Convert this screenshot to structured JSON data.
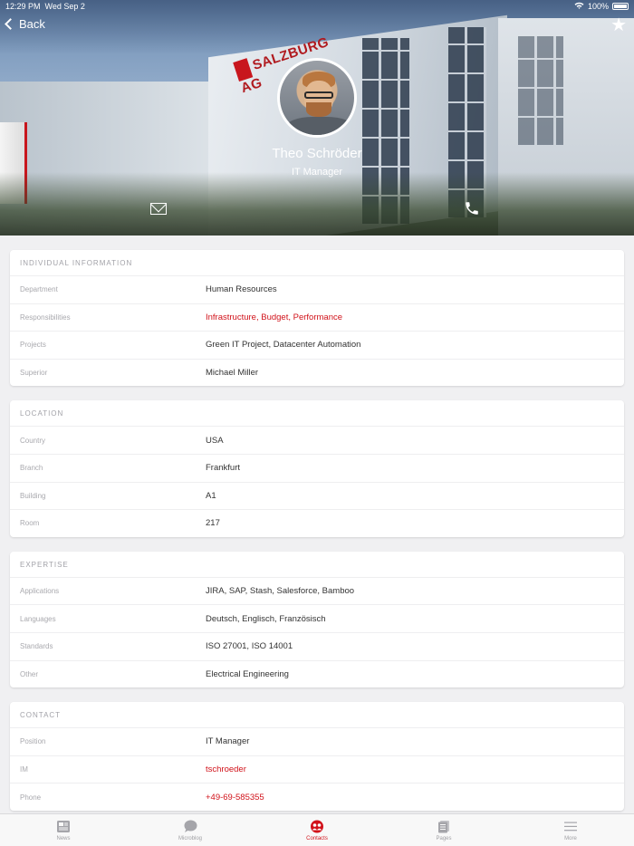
{
  "status_bar": {
    "time": "12:29 PM",
    "date": "Wed Sep 2",
    "battery": "100%"
  },
  "header": {
    "back_label": "Back",
    "sign_text": "SALZBURG AG",
    "name": "Theo Schröder",
    "role": "IT Manager"
  },
  "sections": [
    {
      "title": "INDIVIDUAL INFORMATION",
      "rows": [
        {
          "label": "Department",
          "value": "Human Resources",
          "link": false
        },
        {
          "label": "Responsibilities",
          "value": "Infrastructure, Budget, Performance",
          "link": true
        },
        {
          "label": "Projects",
          "value": "Green IT Project, Datacenter Automation",
          "link": false
        },
        {
          "label": "Superior",
          "value": "Michael Miller",
          "link": false
        }
      ]
    },
    {
      "title": "LOCATION",
      "rows": [
        {
          "label": "Country",
          "value": "USA",
          "link": false
        },
        {
          "label": "Branch",
          "value": "Frankfurt",
          "link": false
        },
        {
          "label": "Building",
          "value": "A1",
          "link": false
        },
        {
          "label": "Room",
          "value": "217",
          "link": false
        }
      ]
    },
    {
      "title": "EXPERTISE",
      "rows": [
        {
          "label": "Applications",
          "value": "JIRA, SAP, Stash, Salesforce, Bamboo",
          "link": false
        },
        {
          "label": "Languages",
          "value": "Deutsch, Englisch, Französisch",
          "link": false
        },
        {
          "label": "Standards",
          "value": "ISO 27001, ISO 14001",
          "link": false
        },
        {
          "label": "Other",
          "value": "Electrical Engineering",
          "link": false
        }
      ]
    },
    {
      "title": "CONTACT",
      "rows": [
        {
          "label": "Position",
          "value": "IT Manager",
          "link": false
        },
        {
          "label": "IM",
          "value": "tschroeder",
          "link": true
        },
        {
          "label": "Phone",
          "value": "+49-69-585355",
          "link": true
        }
      ]
    }
  ],
  "tabs": [
    {
      "label": "News",
      "icon": "news-icon",
      "active": false
    },
    {
      "label": "Microblog",
      "icon": "microblog-icon",
      "active": false
    },
    {
      "label": "Contacts",
      "icon": "contacts-icon",
      "active": true
    },
    {
      "label": "Pages",
      "icon": "pages-icon",
      "active": false
    },
    {
      "label": "More",
      "icon": "more-icon",
      "active": false
    }
  ],
  "colors": {
    "accent": "#d1121a",
    "label": "#a9a9ae",
    "background": "#f0f0f2"
  }
}
